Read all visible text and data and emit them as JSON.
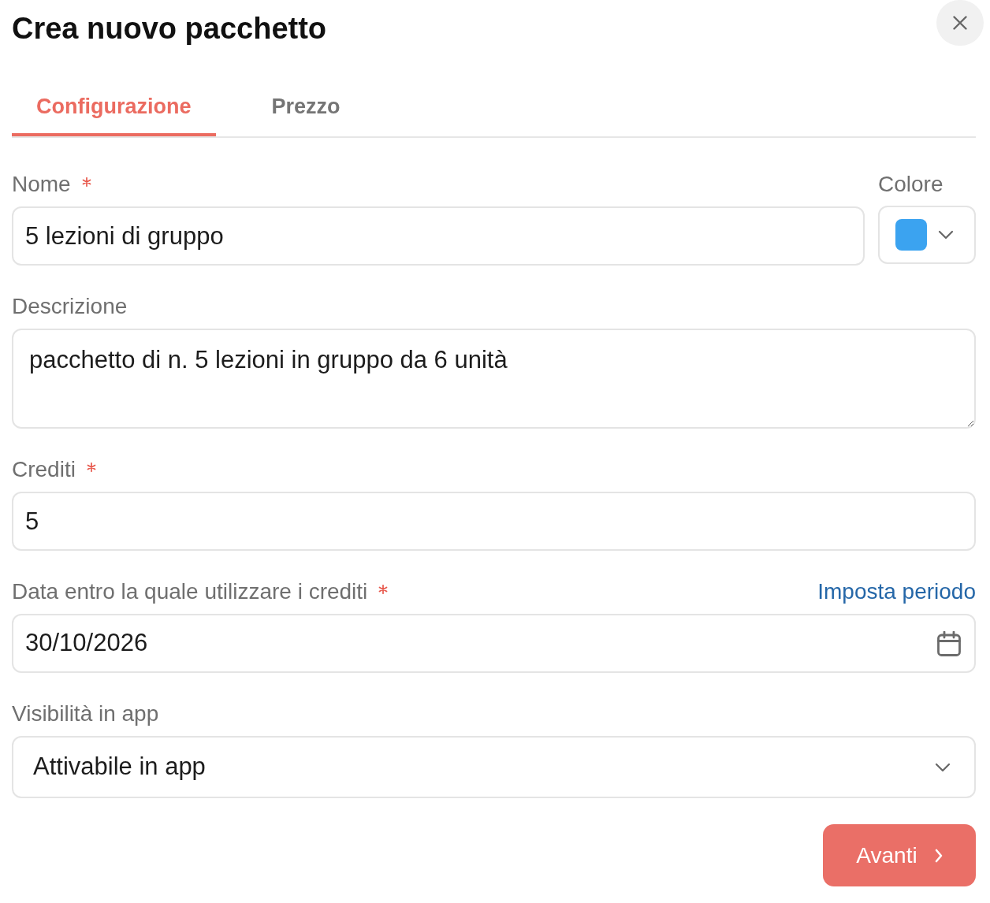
{
  "dialog": {
    "title": "Crea nuovo pacchetto"
  },
  "tabs": [
    {
      "label": "Configurazione",
      "selected": true
    },
    {
      "label": "Prezzo",
      "selected": false
    }
  ],
  "form": {
    "name": {
      "label": "Nome",
      "required": true,
      "value": "5 lezioni di gruppo"
    },
    "color": {
      "label": "Colore",
      "color": "#3ba3f0"
    },
    "description": {
      "label": "Descrizione",
      "required": false,
      "value": "pacchetto di n. 5 lezioni in gruppo da 6 unità"
    },
    "credits": {
      "label": "Crediti",
      "required": true,
      "value": "5"
    },
    "expiry_date": {
      "label": "Data entro la quale utilizzare i crediti",
      "required": true,
      "value": "30/10/2026",
      "link": "Imposta periodo"
    },
    "app_visibility": {
      "label": "Visibilità in app",
      "required": false,
      "value": "Attivabile in app"
    }
  },
  "next_button": {
    "label": "Avanti"
  }
}
